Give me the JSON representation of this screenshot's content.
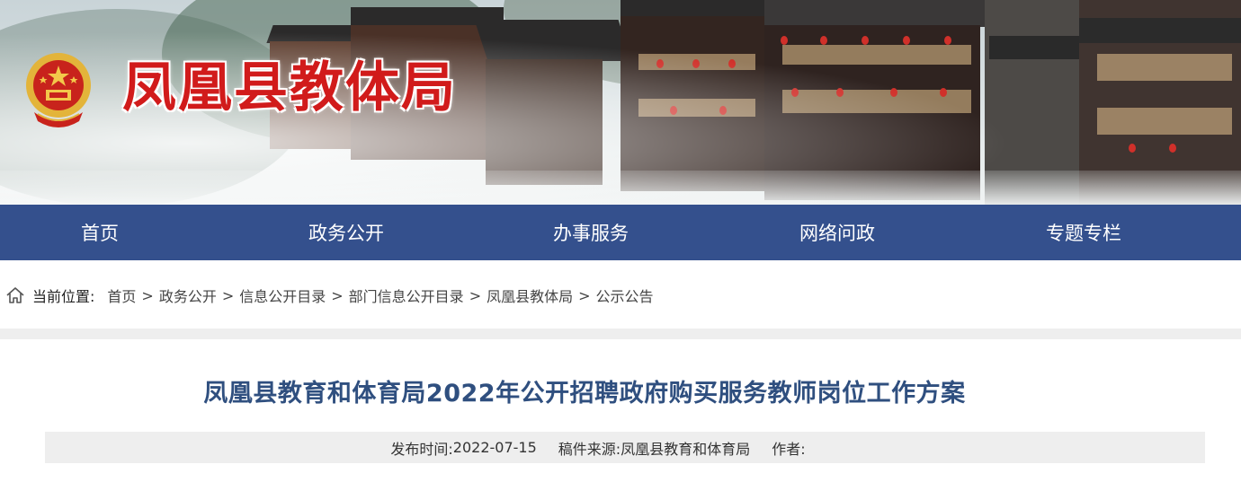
{
  "header": {
    "site_title": "凤凰县教体局",
    "emblem_icon": "national-emblem-icon",
    "brand_red": "#d11b1b"
  },
  "nav": {
    "background": "#34508d",
    "items": [
      {
        "label": "首页"
      },
      {
        "label": "政务公开"
      },
      {
        "label": "办事服务"
      },
      {
        "label": "网络问政"
      },
      {
        "label": "专题专栏"
      }
    ]
  },
  "breadcrumb": {
    "icon": "home-icon",
    "label": "当前位置:",
    "separator": ">",
    "items": [
      "首页",
      "政务公开",
      "信息公开目录",
      "部门信息公开目录",
      "凤凰县教体局",
      "公示公告"
    ]
  },
  "article": {
    "title": "凤凰县教育和体育局2022年公开招聘政府购买服务教师岗位工作方案",
    "title_color": "#2f4f7f",
    "publish_label": "发布时间:",
    "publish_date": "2022-07-15",
    "source_label": "稿件来源:",
    "source": "凤凰县教育和体育局",
    "author_label": "作者:",
    "author": ""
  }
}
